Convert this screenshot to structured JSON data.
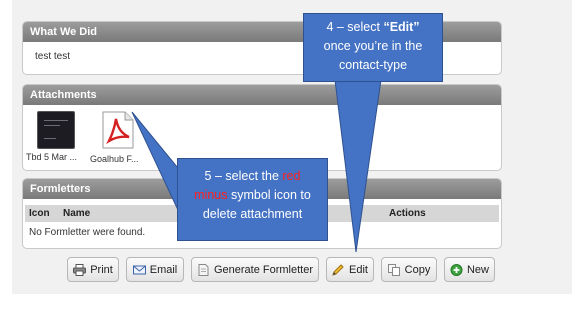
{
  "what_we_did": {
    "title": "What We Did",
    "text": "test test"
  },
  "attachments": {
    "title": "Attachments",
    "items": [
      {
        "label": "Tbd 5 Mar ...",
        "icon": "image-thumbnail-icon"
      },
      {
        "label": "Goalhub F...",
        "icon": "pdf-file-icon"
      }
    ]
  },
  "formletters": {
    "title": "Formletters",
    "columns": [
      "Icon",
      "Name",
      "Actions"
    ],
    "empty_text": "No Formletter were found."
  },
  "buttons": {
    "print": "Print",
    "email": "Email",
    "generate": "Generate Formletter",
    "edit": "Edit",
    "copy": "Copy",
    "new": "New"
  },
  "callout_edit": {
    "line1_prefix": "4 – select ",
    "line1_bold": "“Edit”",
    "line2": "once you’re in the",
    "line3": "contact-type"
  },
  "callout_delete": {
    "line1_prefix": "5 – select the ",
    "line1_red": "red",
    "line2_red": "minus",
    "line2_rest": " symbol icon to",
    "line3": "delete attachment"
  },
  "colors": {
    "callout": "#4472c4",
    "header": "#8a8a8a",
    "highlight": "#ff2020"
  }
}
